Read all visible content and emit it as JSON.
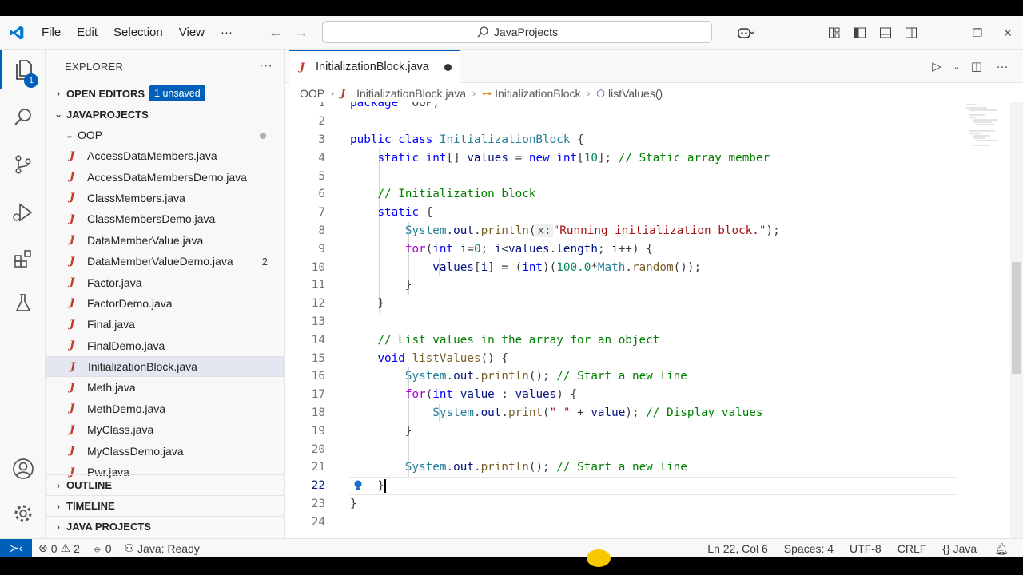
{
  "menu": [
    "File",
    "Edit",
    "Selection",
    "View"
  ],
  "command_center": "JavaProjects",
  "activity": {
    "explorer_badge": "1"
  },
  "sidebar": {
    "title": "EXPLORER",
    "open_editors": {
      "label": "OPEN EDITORS",
      "badge": "1 unsaved"
    },
    "project": "JAVAPROJECTS",
    "folder": "OOP",
    "files": [
      {
        "name": "AccessDataMembers.java",
        "count": ""
      },
      {
        "name": "AccessDataMembersDemo.java",
        "count": ""
      },
      {
        "name": "ClassMembers.java",
        "count": ""
      },
      {
        "name": "ClassMembersDemo.java",
        "count": ""
      },
      {
        "name": "DataMemberValue.java",
        "count": ""
      },
      {
        "name": "DataMemberValueDemo.java",
        "count": "2"
      },
      {
        "name": "Factor.java",
        "count": ""
      },
      {
        "name": "FactorDemo.java",
        "count": ""
      },
      {
        "name": "Final.java",
        "count": ""
      },
      {
        "name": "FinalDemo.java",
        "count": ""
      },
      {
        "name": "InitializationBlock.java",
        "count": "",
        "selected": true
      },
      {
        "name": "Meth.java",
        "count": ""
      },
      {
        "name": "MethDemo.java",
        "count": ""
      },
      {
        "name": "MyClass.java",
        "count": ""
      },
      {
        "name": "MyClassDemo.java",
        "count": ""
      },
      {
        "name": "Pwr.java",
        "count": ""
      }
    ],
    "sections": [
      "OUTLINE",
      "TIMELINE",
      "JAVA PROJECTS"
    ]
  },
  "editor": {
    "tab": "InitializationBlock.java",
    "breadcrumb": [
      "OOP",
      "InitializationBlock.java",
      "InitializationBlock",
      "listValues()"
    ],
    "current_line": 22,
    "lines": [
      [
        [
          "kw",
          "package"
        ],
        [
          "",
          "  OOP;"
        ]
      ],
      [],
      [
        [
          "kw",
          "public"
        ],
        [
          "",
          " "
        ],
        [
          "kw",
          "class"
        ],
        [
          "",
          " "
        ],
        [
          "ty",
          "InitializationBlock"
        ],
        [
          "",
          " {"
        ]
      ],
      [
        [
          "",
          "    "
        ],
        [
          "kw",
          "static"
        ],
        [
          "",
          " "
        ],
        [
          "kw",
          "int"
        ],
        [
          "",
          "[] "
        ],
        [
          "vr",
          "values"
        ],
        [
          "",
          " = "
        ],
        [
          "kw",
          "new"
        ],
        [
          "",
          " "
        ],
        [
          "kw",
          "int"
        ],
        [
          "",
          "["
        ],
        [
          "nm",
          "10"
        ],
        [
          "",
          "]; "
        ],
        [
          "cm",
          "// Static array member"
        ]
      ],
      [],
      [
        [
          "",
          "    "
        ],
        [
          "cm",
          "// Initialization block"
        ]
      ],
      [
        [
          "",
          "    "
        ],
        [
          "kw",
          "static"
        ],
        [
          "",
          " {"
        ]
      ],
      [
        [
          "",
          "        "
        ],
        [
          "ty",
          "System"
        ],
        [
          "",
          "."
        ],
        [
          "vr",
          "out"
        ],
        [
          "",
          "."
        ],
        [
          "fn",
          "println"
        ],
        [
          "",
          "("
        ],
        [
          "hint",
          "x:"
        ],
        [
          "st",
          "\"Running initialization block.\""
        ],
        [
          "",
          ");"
        ]
      ],
      [
        [
          "",
          "        "
        ],
        [
          "kc",
          "for"
        ],
        [
          "",
          "("
        ],
        [
          "kw",
          "int"
        ],
        [
          "",
          " "
        ],
        [
          "vr",
          "i"
        ],
        [
          "",
          "="
        ],
        [
          "nm",
          "0"
        ],
        [
          "",
          "; "
        ],
        [
          "vr",
          "i"
        ],
        [
          "",
          "<"
        ],
        [
          "vr",
          "values"
        ],
        [
          "",
          "."
        ],
        [
          "vr",
          "length"
        ],
        [
          "",
          "; "
        ],
        [
          "vr",
          "i"
        ],
        [
          "",
          "++) {"
        ]
      ],
      [
        [
          "",
          "            "
        ],
        [
          "vr",
          "values"
        ],
        [
          "",
          "["
        ],
        [
          "vr",
          "i"
        ],
        [
          "",
          "] = ("
        ],
        [
          "kw",
          "int"
        ],
        [
          "",
          ")("
        ],
        [
          "nm",
          "100.0"
        ],
        [
          "",
          "*"
        ],
        [
          "ty",
          "Math"
        ],
        [
          "",
          "."
        ],
        [
          "fn",
          "random"
        ],
        [
          "",
          "());"
        ]
      ],
      [
        [
          "",
          "        }"
        ]
      ],
      [
        [
          "",
          "    }"
        ]
      ],
      [],
      [
        [
          "",
          "    "
        ],
        [
          "cm",
          "// List values in the array for an object"
        ]
      ],
      [
        [
          "",
          "    "
        ],
        [
          "kw",
          "void"
        ],
        [
          "",
          " "
        ],
        [
          "fn",
          "listValues"
        ],
        [
          "",
          "() {"
        ]
      ],
      [
        [
          "",
          "        "
        ],
        [
          "ty",
          "System"
        ],
        [
          "",
          "."
        ],
        [
          "vr",
          "out"
        ],
        [
          "",
          "."
        ],
        [
          "fn",
          "println"
        ],
        [
          "",
          "(); "
        ],
        [
          "cm",
          "// Start a new line"
        ]
      ],
      [
        [
          "",
          "        "
        ],
        [
          "kc",
          "for"
        ],
        [
          "",
          "("
        ],
        [
          "kw",
          "int"
        ],
        [
          "",
          " "
        ],
        [
          "vr",
          "value"
        ],
        [
          "",
          " : "
        ],
        [
          "vr",
          "values"
        ],
        [
          "",
          ") {"
        ]
      ],
      [
        [
          "",
          "            "
        ],
        [
          "ty",
          "System"
        ],
        [
          "",
          "."
        ],
        [
          "vr",
          "out"
        ],
        [
          "",
          "."
        ],
        [
          "fn",
          "print"
        ],
        [
          "",
          "("
        ],
        [
          "st",
          "\" \""
        ],
        [
          "",
          " + "
        ],
        [
          "vr",
          "value"
        ],
        [
          "",
          "); "
        ],
        [
          "cm",
          "// Display values"
        ]
      ],
      [
        [
          "",
          "        }"
        ]
      ],
      [],
      [
        [
          "",
          "        "
        ],
        [
          "ty",
          "System"
        ],
        [
          "",
          "."
        ],
        [
          "vr",
          "out"
        ],
        [
          "",
          "."
        ],
        [
          "fn",
          "println"
        ],
        [
          "",
          "(); "
        ],
        [
          "cm",
          "// Start a new line"
        ]
      ],
      [
        [
          "",
          "    }"
        ]
      ],
      [
        [
          "",
          "}"
        ]
      ],
      []
    ]
  },
  "status": {
    "errors": "0",
    "warnings": "2",
    "ports": "0",
    "java": "Java: Ready",
    "position": "Ln 22, Col 6",
    "spaces": "Spaces: 4",
    "encoding": "UTF-8",
    "eol": "CRLF",
    "language": "Java"
  },
  "colors": {
    "accent": "#005fb8",
    "keyword": "#0000ff",
    "comment": "#008000",
    "string": "#a31515"
  }
}
